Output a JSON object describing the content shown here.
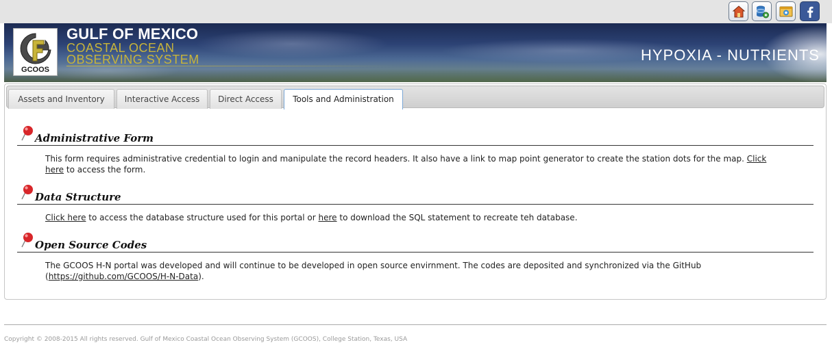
{
  "toolbar": {
    "icons": [
      {
        "name": "home-icon"
      },
      {
        "name": "database-settings-icon"
      },
      {
        "name": "browser-window-icon"
      },
      {
        "name": "facebook-icon"
      }
    ]
  },
  "header": {
    "logo_text": "GCOOS",
    "org_line1": "GULF OF MEXICO",
    "org_line2": "COASTAL OCEAN",
    "org_line3": "OBSERVING SYSTEM",
    "app_title": "HYPOXIA - NUTRIENTS"
  },
  "tabs": [
    {
      "label": "Assets and Inventory",
      "active": false
    },
    {
      "label": "Interactive Access",
      "active": false
    },
    {
      "label": "Direct Access",
      "active": false
    },
    {
      "label": "Tools and Administration",
      "active": true
    }
  ],
  "sections": {
    "admin": {
      "title": "Administrative Form",
      "text_before": "This form requires administrative credential to login and manipulate the record headers. It also have a link to map point generator to create the station dots for the map. ",
      "link_text": "Click here",
      "text_after": " to access the form."
    },
    "data": {
      "title": "Data Structure",
      "link1_text": "Click here",
      "text_middle": " to access the database structure used for this portal or ",
      "link2_text": "here",
      "text_after": " to download the SQL statement to recreate teh database."
    },
    "opensource": {
      "title": "Open Source Codes",
      "text_before": "The GCOOS H-N portal was developed and will continue to be developed in open source envirnment. The codes are deposited and synchronized via the GitHub (",
      "link_text": "https://github.com/GCOOS/H-N-Data",
      "text_after": ")."
    }
  },
  "footer": {
    "copyright": "Copyright © 2008-2015 All rights reserved. Gulf of Mexico Coastal Ocean Observing System (GCOOS), College Station, Texas, USA"
  },
  "colors": {
    "accent_gold": "#c8b43a",
    "active_tab_border": "#7aa7d6",
    "facebook_blue": "#3b5998"
  }
}
